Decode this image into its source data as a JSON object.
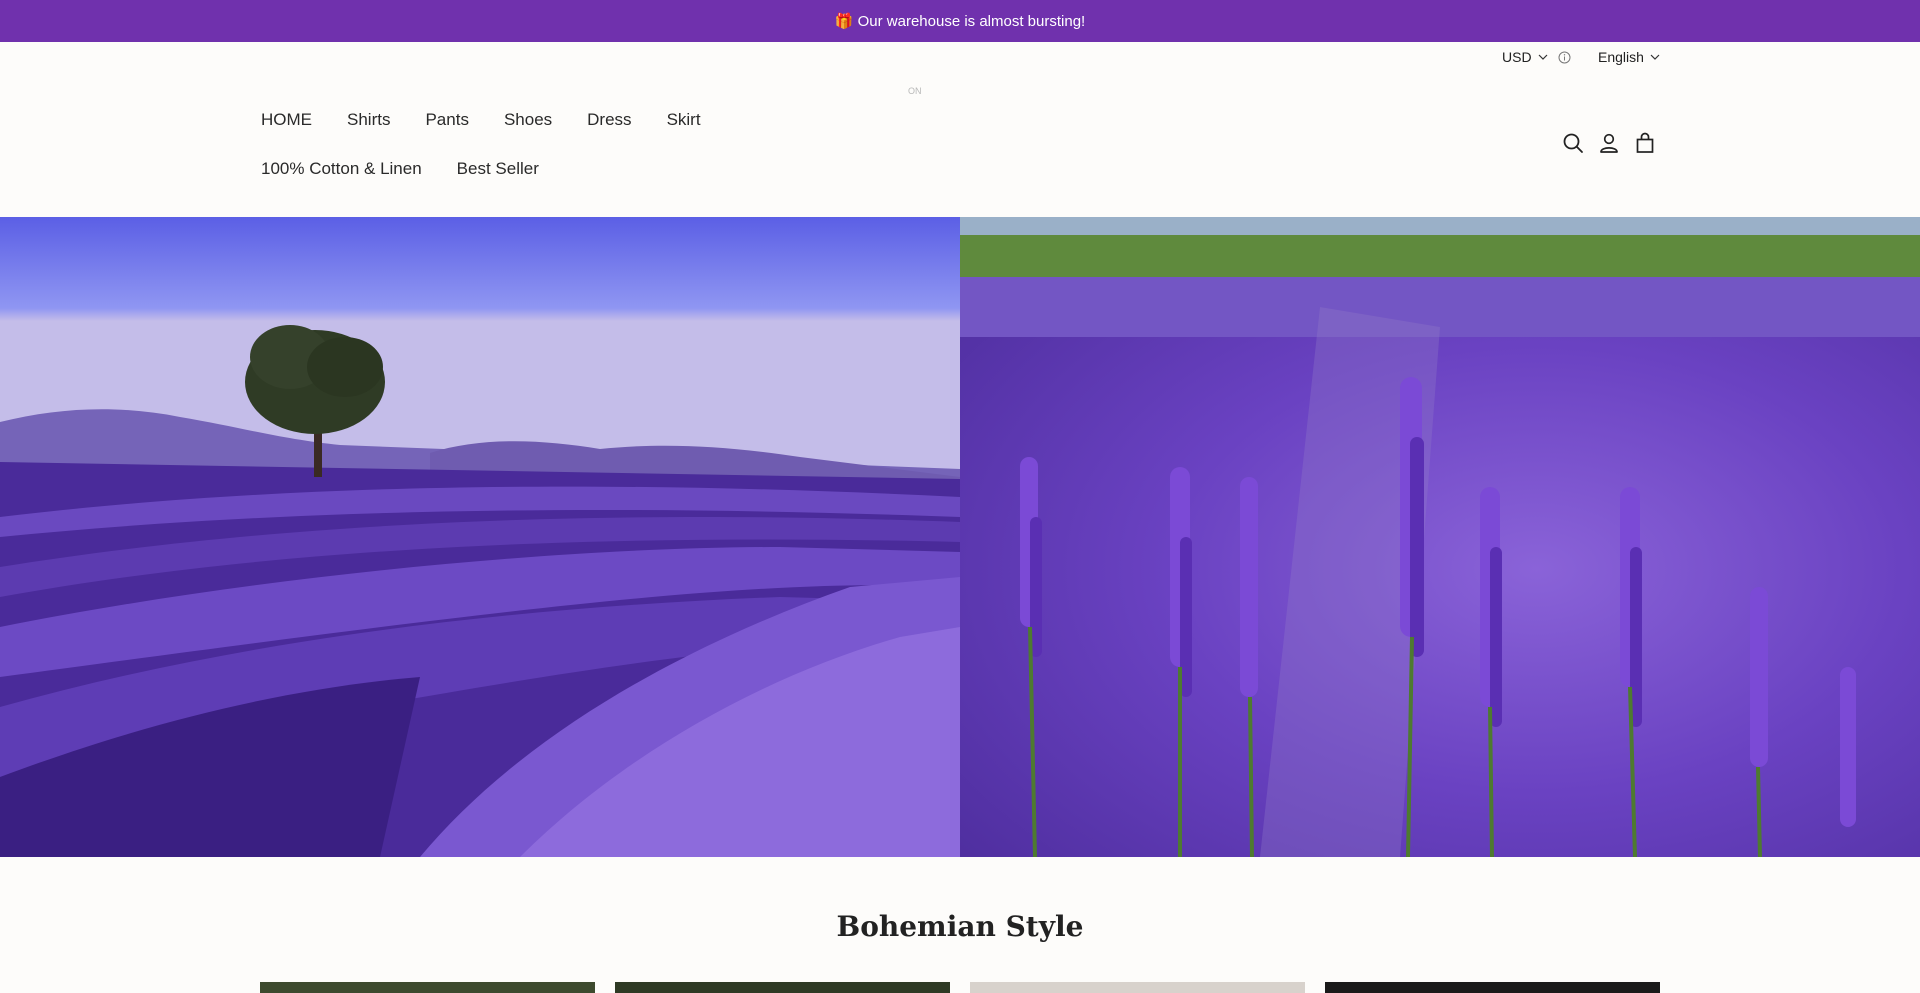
{
  "announcement": {
    "text": "🎁 Our warehouse is almost bursting!",
    "background": "#7031ad"
  },
  "topbar": {
    "currency": "USD",
    "language": "English"
  },
  "logo": {
    "text": "ON"
  },
  "nav": {
    "row1": [
      "HOME",
      "Shirts",
      "Pants",
      "Shoes",
      "Dress",
      "Skirt"
    ],
    "row2": [
      "100% Cotton & Linen",
      "Best Seller"
    ]
  },
  "header_icons": [
    "search-icon",
    "account-icon",
    "cart-icon"
  ],
  "hero": {
    "left_image": "lavender field with tree",
    "right_image": "lavender flowers close-up"
  },
  "section": {
    "title": "Bohemian Style"
  },
  "product_cards": [
    {
      "color": "#3d4a2e"
    },
    {
      "color": "#2f3a24"
    },
    {
      "color": "#d8d2cc"
    },
    {
      "color": "#1a1a1a"
    }
  ]
}
